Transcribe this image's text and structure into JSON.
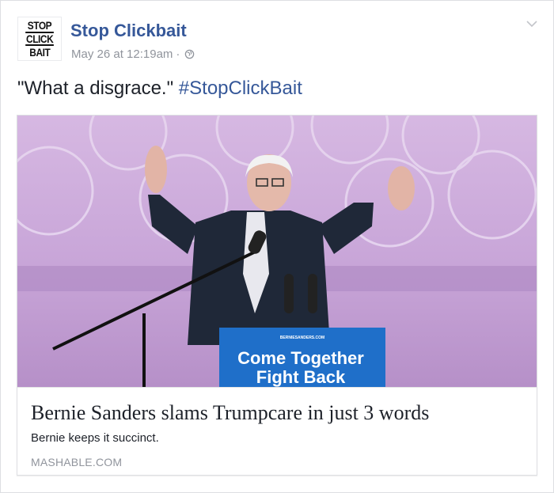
{
  "page": {
    "name": "Stop Clickbait",
    "avatar_lines": [
      "STOP",
      "CLICK",
      "BAIT"
    ]
  },
  "meta": {
    "timestamp": "May 26 at 12:19am",
    "separator": "·",
    "privacy_icon": "globe-icon"
  },
  "menu_icon": "chevron-down-icon",
  "post": {
    "text": "\"What a disgrace.\" ",
    "hashtag": "#StopClickBait"
  },
  "link": {
    "image_sign_top": "Come Together",
    "image_sign_bottom": "Fight Back",
    "image_sign_small": "BERNIESANDERS.COM",
    "headline": "Bernie Sanders slams Trumpcare in just 3 words",
    "subtitle": "Bernie keeps it succinct.",
    "domain": "MASHABLE.COM"
  },
  "colors": {
    "link_blue": "#365899",
    "meta_gray": "#90949c",
    "image_backdrop": "#c8a8d6",
    "podium_blue": "#1f6fc9"
  }
}
